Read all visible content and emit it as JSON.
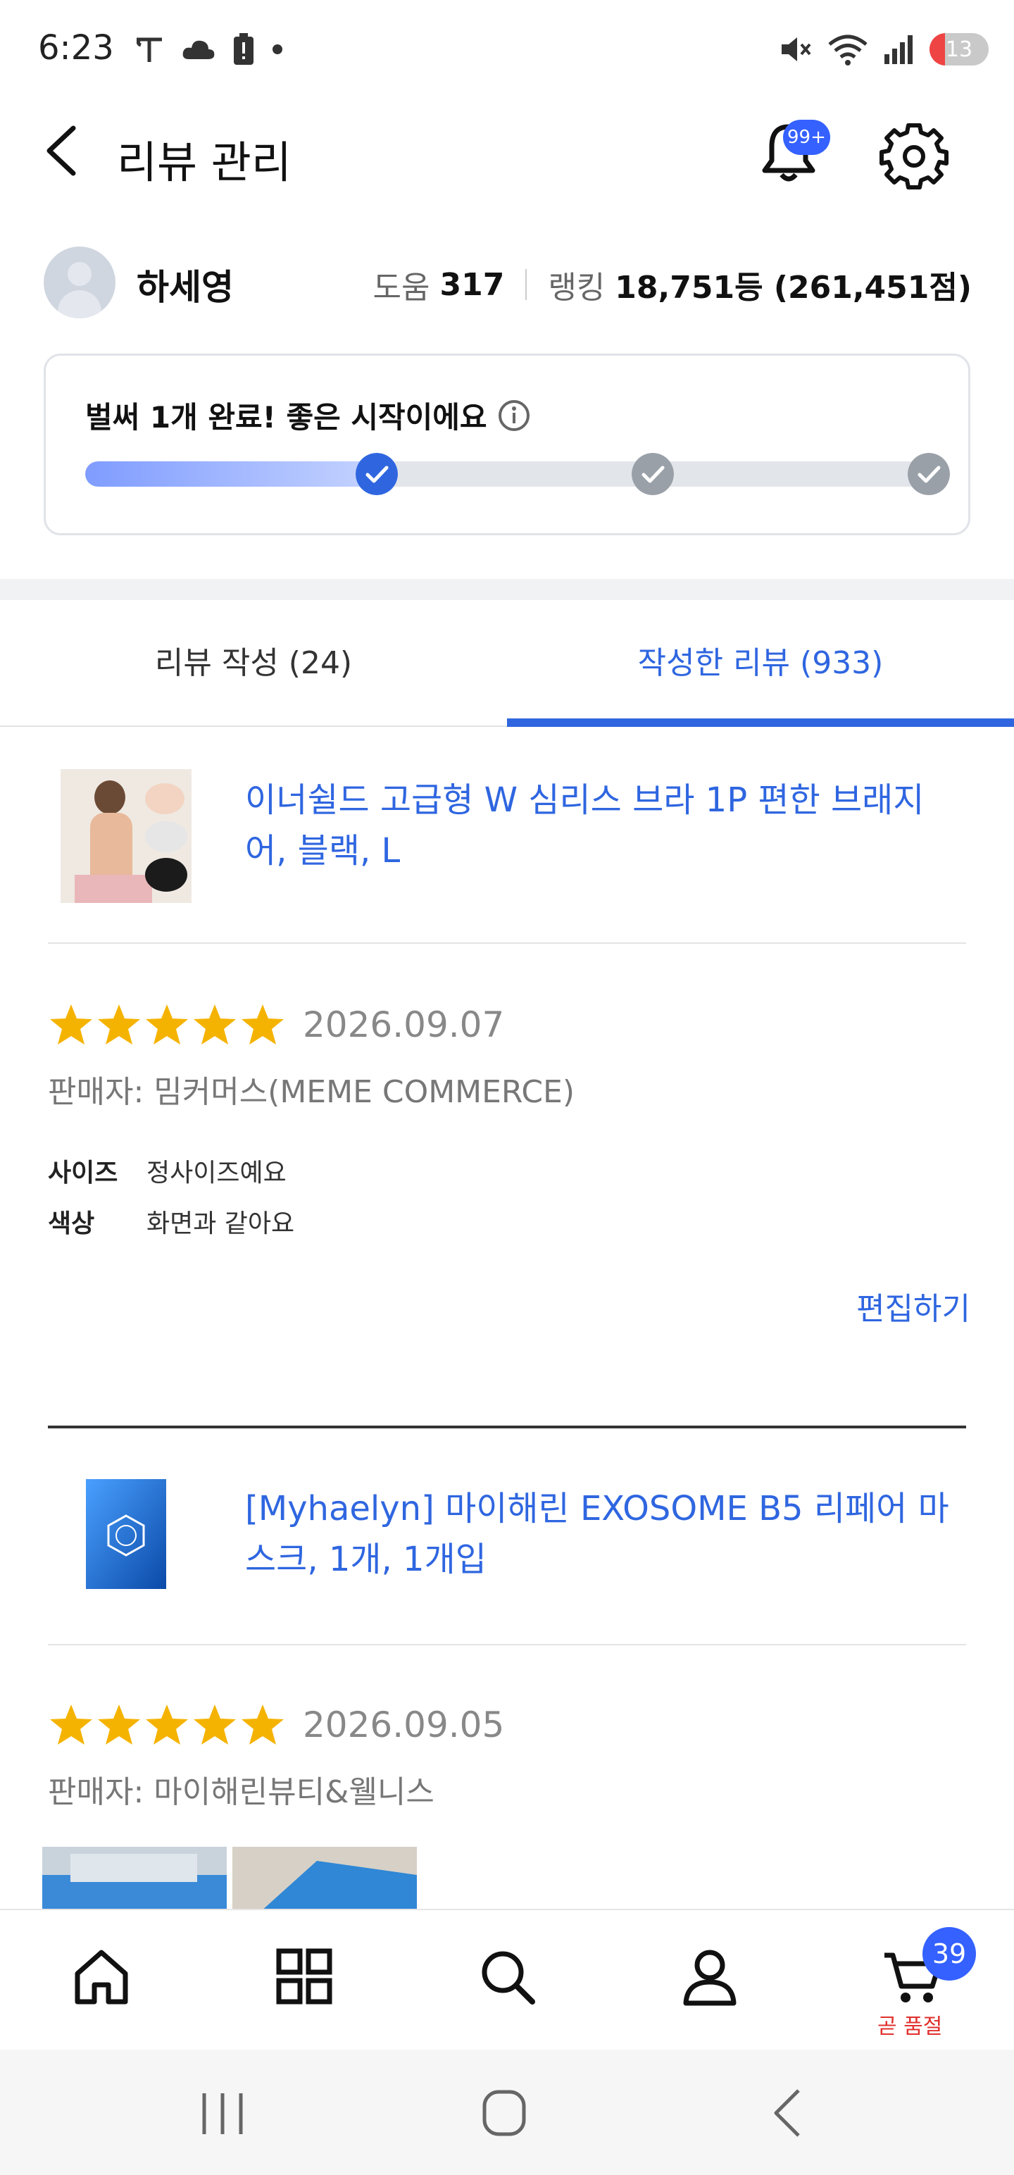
{
  "status_bar": {
    "time": "6:23",
    "battery": "13"
  },
  "header": {
    "title": "리뷰 관리",
    "notification_badge": "99+"
  },
  "profile": {
    "name": "하세영",
    "help_label": "도움",
    "help_value": "317",
    "ranking_label": "랭킹",
    "ranking_value": "18,751등 (261,451점)"
  },
  "progress": {
    "message": "벌써 1개 완료! 좋은 시작이에요",
    "completed_steps": 1,
    "total_steps": 3
  },
  "tabs": [
    {
      "label": "리뷰 작성 (24)",
      "active": false
    },
    {
      "label": "작성한 리뷰 (933)",
      "active": true
    }
  ],
  "reviews": [
    {
      "product_title": "이너쉴드 고급형 W 심리스 브라 1P 편한 브래지어, 블랙, L",
      "rating": 5,
      "date": "2026.09.07",
      "seller": "판매자: 밈커머스(MEME COMMERCE)",
      "attributes": [
        {
          "key": "사이즈",
          "value": "정사이즈예요"
        },
        {
          "key": "색상",
          "value": "화면과 같아요"
        }
      ],
      "edit_label": "편집하기"
    },
    {
      "product_title": "[Myhaelyn] 마이해린 EXOSOME B5 리페어 마스크, 1개, 1개입",
      "rating": 5,
      "date": "2026.09.05",
      "seller": "판매자: 마이해린뷰티&웰니스"
    }
  ],
  "bottom_nav": {
    "items": [
      "home-icon",
      "categories-icon",
      "search-icon",
      "account-icon",
      "cart-icon"
    ],
    "cart_count": "39",
    "cart_label": "곧 품절"
  },
  "colors": {
    "accent": "#2f66e0",
    "badge": "#3461ff",
    "star": "#f5b301",
    "warning": "#e0302d"
  }
}
